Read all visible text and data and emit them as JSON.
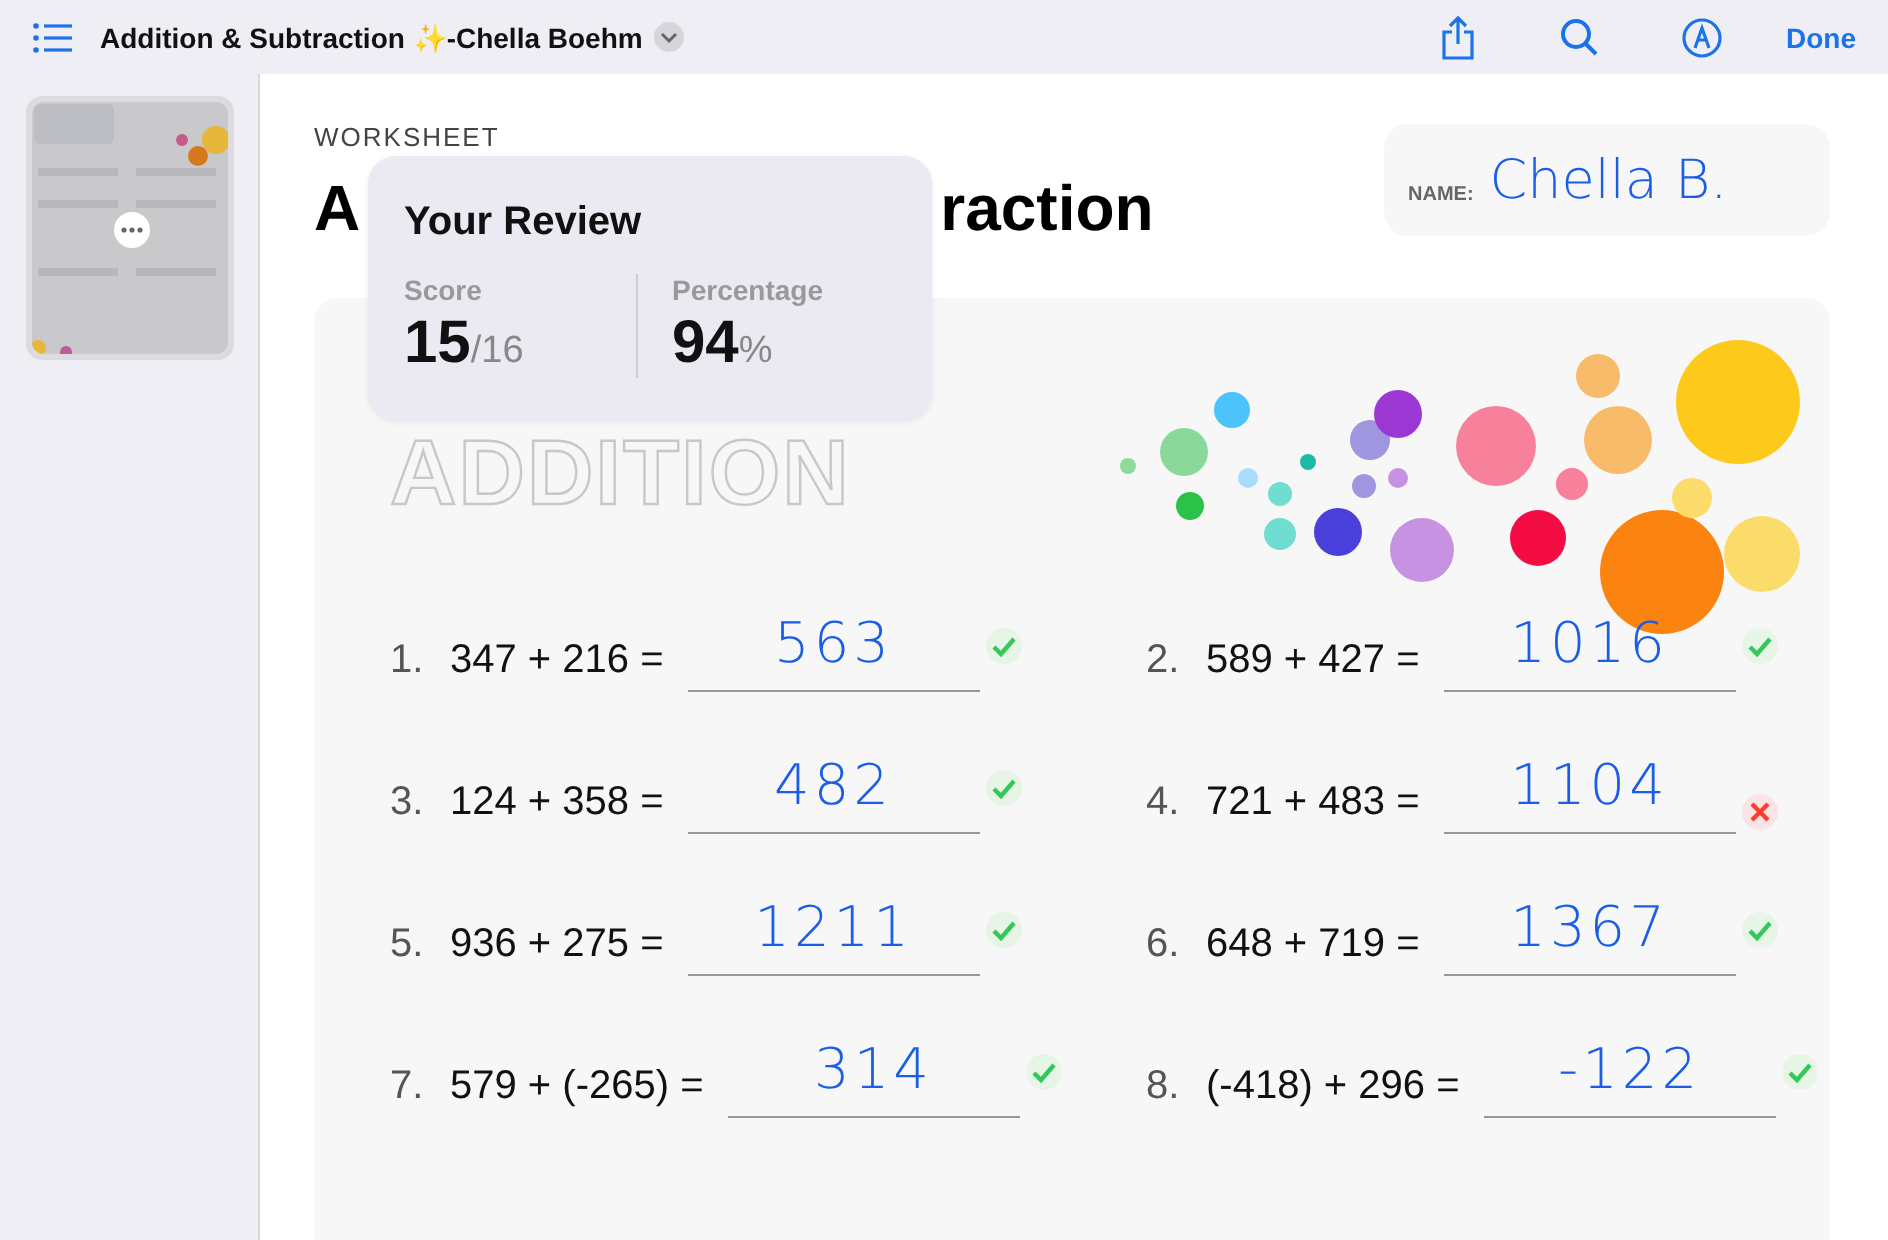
{
  "toolbar": {
    "title": "Addition & Subtraction ✨-Chella Boehm",
    "done": "Done"
  },
  "sidebar": {
    "thumbnails": [
      {
        "selected": true
      }
    ]
  },
  "worksheet": {
    "label": "WORKSHEET",
    "title_parts": [
      "A",
      "raction"
    ],
    "name_label": "NAME:",
    "name_value": "Chella B.",
    "section": "ADDITION",
    "problems": [
      {
        "number": "1.",
        "expression": "347 + 216 =",
        "answer": "563",
        "correct": true
      },
      {
        "number": "2.",
        "expression": "589 + 427 =",
        "answer": "1016",
        "correct": true
      },
      {
        "number": "3.",
        "expression": "124 + 358 =",
        "answer": "482",
        "correct": true
      },
      {
        "number": "4.",
        "expression": "721 + 483 =",
        "answer": "1104",
        "correct": false
      },
      {
        "number": "5.",
        "expression": "936 + 275 =",
        "answer": "1211",
        "correct": true
      },
      {
        "number": "6.",
        "expression": "648 + 719 =",
        "answer": "1367",
        "correct": true
      },
      {
        "number": "7.",
        "expression": "579 + (-265) =",
        "answer": "314",
        "correct": true
      },
      {
        "number": "8.",
        "expression": "(-418) + 296 =",
        "answer": "-122",
        "correct": true
      }
    ]
  },
  "review": {
    "title": "Your Review",
    "score_label": "Score",
    "score": "15",
    "score_total": "/16",
    "percentage_label": "Percentage",
    "percentage": "94",
    "percent_sign": "%"
  }
}
